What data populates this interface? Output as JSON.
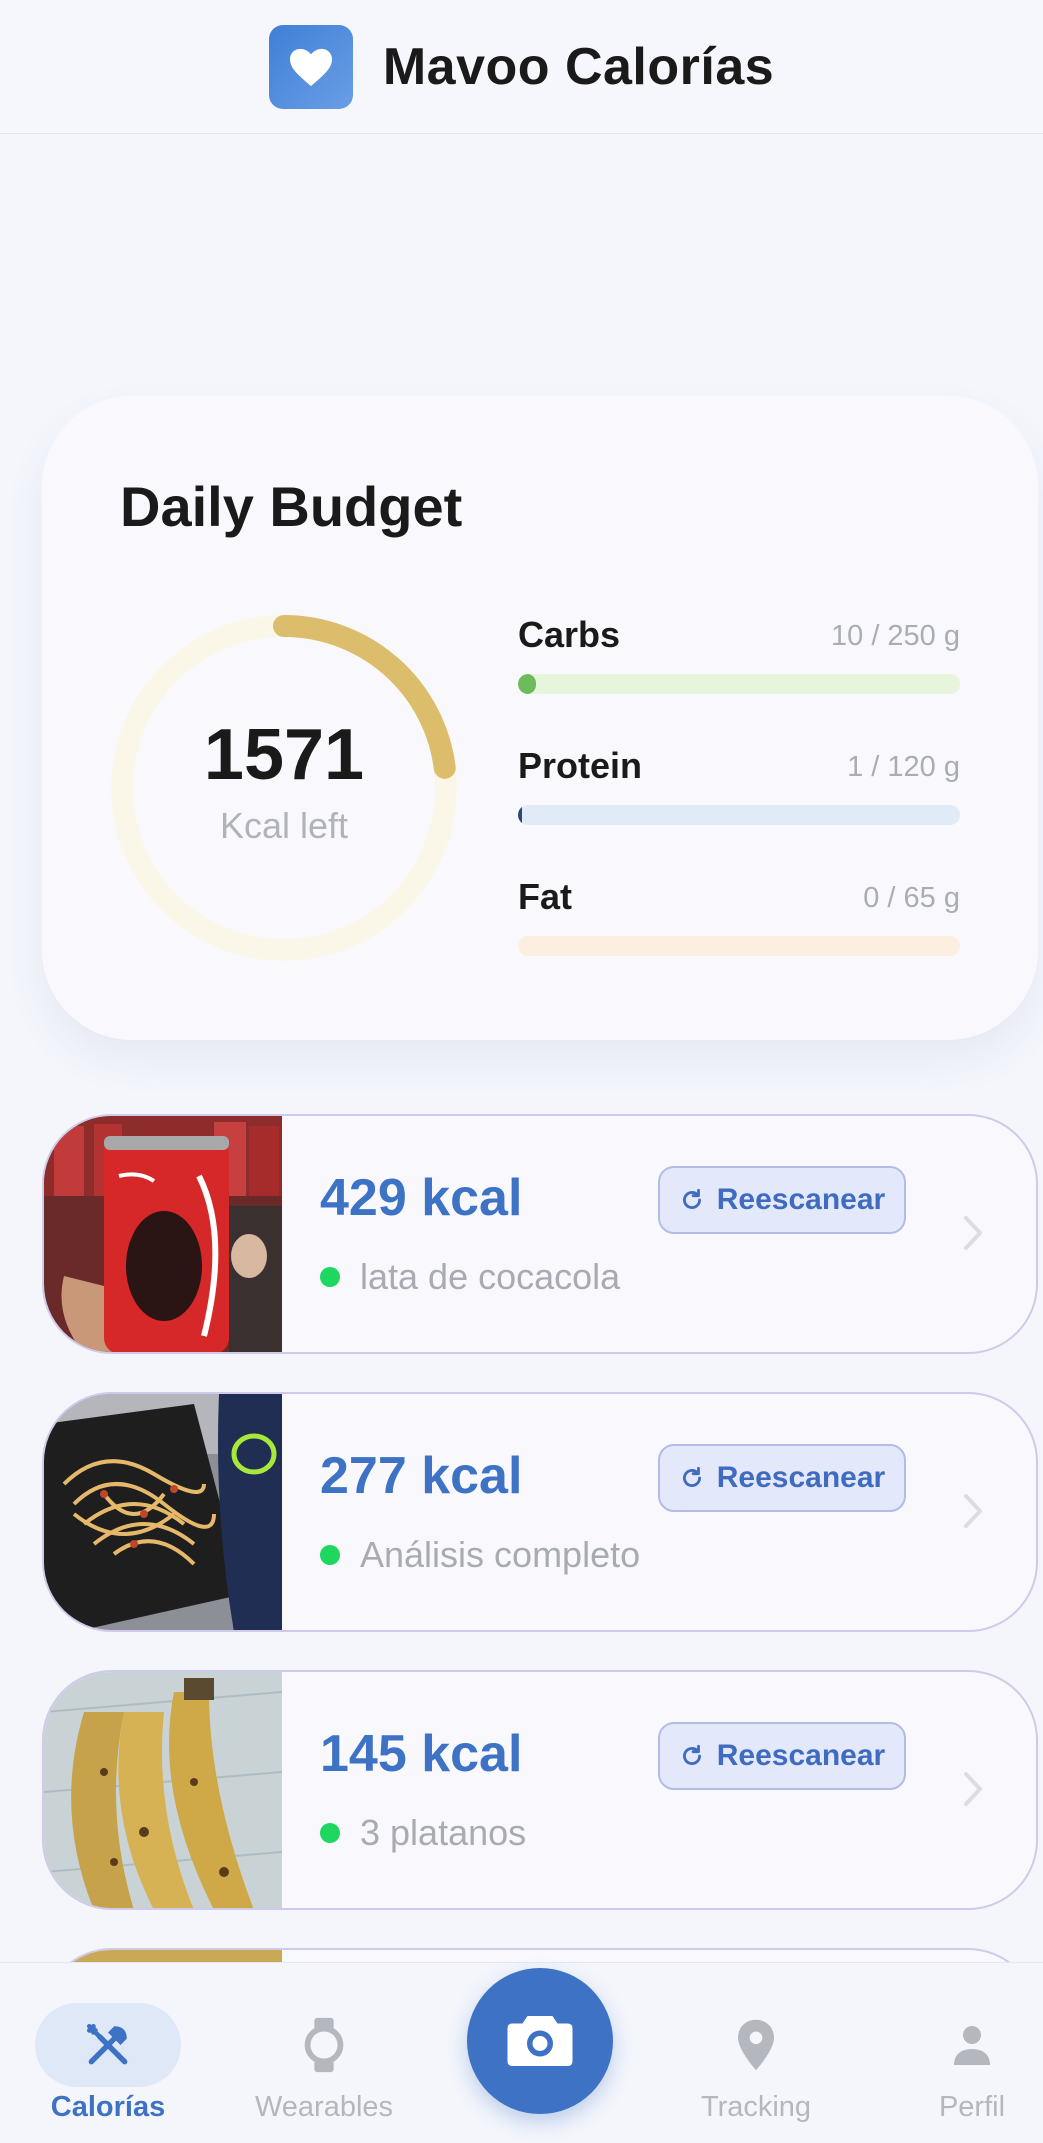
{
  "app": {
    "title": "Mavoo Calorías"
  },
  "budget": {
    "title": "Daily Budget",
    "kcal_left": "1571",
    "kcal_label": "Kcal left",
    "ring_fraction": 0.23,
    "ring_color": "#dcbd6c",
    "macros": [
      {
        "name": "Carbs",
        "value": "10 / 250 g",
        "fraction": 0.04,
        "fill": "#6dbb5a",
        "track": "#e6f5dc"
      },
      {
        "name": "Protein",
        "value": "1 / 120 g",
        "fraction": 0.008,
        "fill": "#2f4a6e",
        "track": "#e1ebf8"
      },
      {
        "name": "Fat",
        "value": "0 / 65 g",
        "fraction": 0.0,
        "fill": "#e8a87a",
        "track": "#fdeee2"
      }
    ]
  },
  "foods": [
    {
      "kcal": "429 kcal",
      "name": "lata de cocacola",
      "rescan": "Reescanear",
      "image": "soda-can-photo"
    },
    {
      "kcal": "277 kcal",
      "name": "Análisis completo",
      "rescan": "Reescanear",
      "image": "pasta-plate-photo"
    },
    {
      "kcal": "145 kcal",
      "name": "3 platanos",
      "rescan": "Reescanear",
      "image": "bananas-photo"
    }
  ],
  "nav": {
    "items": [
      {
        "label": "Calorías",
        "icon": "fork-knife-icon",
        "active": true
      },
      {
        "label": "Wearables",
        "icon": "watch-icon",
        "active": false
      },
      {
        "label": "Tracking",
        "icon": "location-pin-icon",
        "active": false
      },
      {
        "label": "Perfil",
        "icon": "person-icon",
        "active": false
      }
    ],
    "camera_icon": "camera-icon"
  },
  "colors": {
    "accent": "#3d72c4",
    "status_dot": "#1ed760"
  }
}
